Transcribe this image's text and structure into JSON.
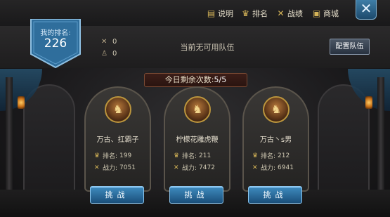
{
  "menu": [
    {
      "icon": "book-icon",
      "glyph": "▤",
      "label": "说明"
    },
    {
      "icon": "trophy-icon",
      "glyph": "♛",
      "label": "排名"
    },
    {
      "icon": "crossed-swords-icon",
      "glyph": "✕",
      "label": "战绩"
    },
    {
      "icon": "chest-icon",
      "glyph": "▣",
      "label": "商城"
    }
  ],
  "close_glyph": "✕",
  "my_rank": {
    "label": "我的排名:",
    "value": "226"
  },
  "stats": [
    {
      "icon": "crossed-swords-icon",
      "glyph": "✕",
      "value": "0"
    },
    {
      "icon": "person-icon",
      "glyph": "♙",
      "value": "0"
    }
  ],
  "team_status": "当前无可用队伍",
  "config_team_label": "配置队伍",
  "remaining": {
    "label": "今日剩余次数:",
    "count": "5/5"
  },
  "opponents": [
    {
      "name": "万古、扛霸子",
      "rank_label": "排名:",
      "rank": "199",
      "power_label": "战力:",
      "power": "7051",
      "button": "挑战"
    },
    {
      "name": "柠檬花雕虎鞭",
      "rank_label": "排名:",
      "rank": "211",
      "power_label": "战力:",
      "power": "7472",
      "button": "挑战"
    },
    {
      "name": "万古丶s男",
      "rank_label": "排名:",
      "rank": "212",
      "power_label": "战力:",
      "power": "6941",
      "button": "挑战"
    }
  ],
  "colors": {
    "accent_gold": "#d5b458",
    "button_blue": "#2f74a8",
    "rank_badge_blue": "#2f6e9c"
  }
}
